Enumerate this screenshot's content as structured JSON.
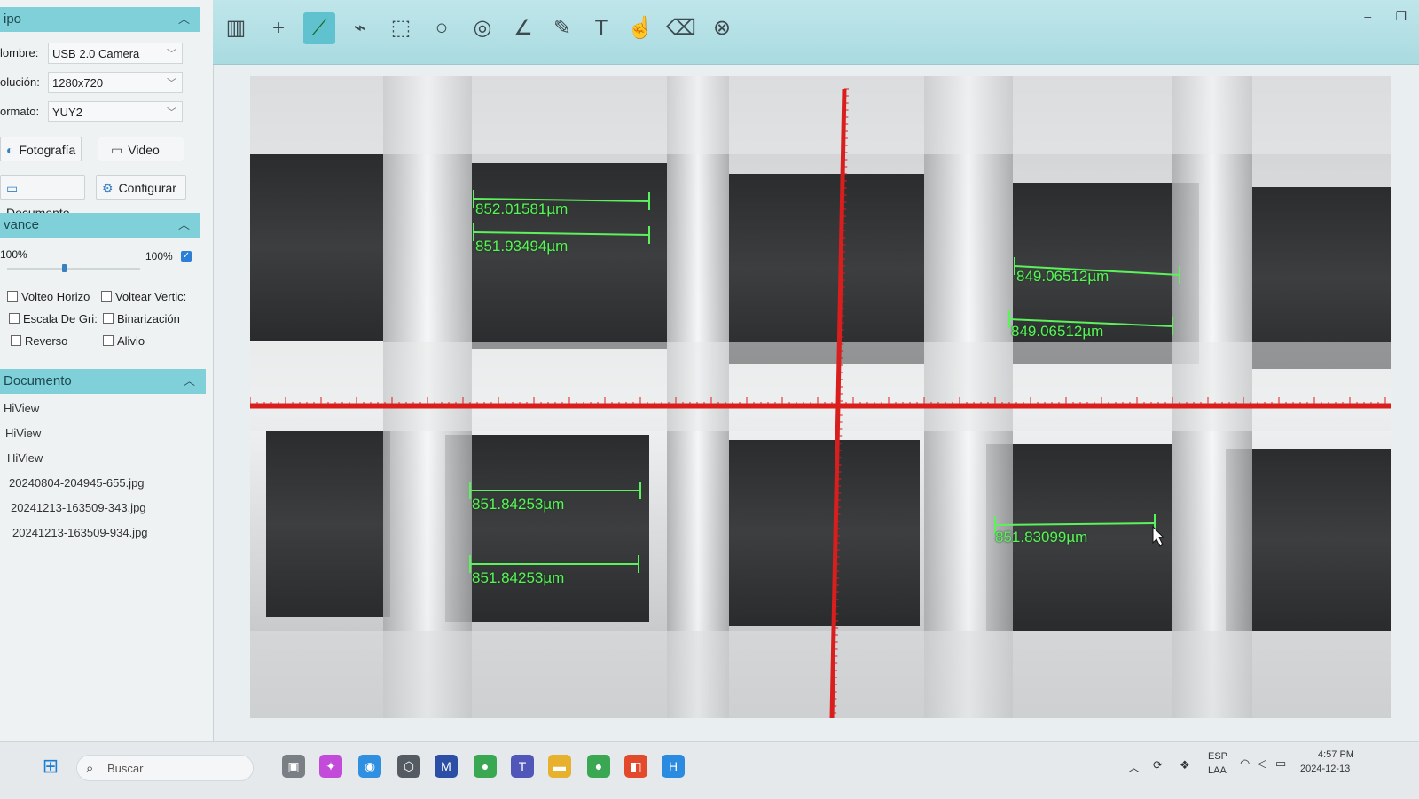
{
  "sidebar": {
    "equipo_header": "ipo",
    "nombre_label": "lombre:",
    "nombre_value": "USB 2.0 Camera",
    "resolucion_label": "olución:",
    "resolucion_value": "1280x720",
    "formato_label": "ormato:",
    "formato_value": "YUY2",
    "buttons": {
      "fotografia": "Fotografía",
      "video": "Video",
      "documento": "Documento",
      "configurar": "Configurar"
    },
    "avance_header": "vance",
    "zoom_left": "100%",
    "zoom_right": "100%",
    "checkboxes": [
      "Volteo Horizo",
      "Voltear Vertic:",
      "Escala De Gri:",
      "Binarización",
      "Reverso",
      "Alivio"
    ],
    "documento_header": "Documento",
    "files": [
      "HiView",
      "HiView",
      "HiView",
      "20240804-204945-655.jpg",
      "20241213-163509-343.jpg",
      "20241213-163509-934.jpg"
    ]
  },
  "toolbar": {
    "tools": [
      "columns-tool-icon",
      "crosshair-icon",
      "line-measure-icon",
      "polyline-icon",
      "rectangle-icon",
      "circle-icon",
      "concentric-circle-icon",
      "angle-icon",
      "pencil-icon",
      "text-icon",
      "hand-icon",
      "erase-icon",
      "close-circle-icon"
    ],
    "active_tool": "line-measure-icon"
  },
  "measurements": {
    "m1": "852.01581µm",
    "m2": "851.93494µm",
    "m3": "849.06512µm",
    "m4": "849.06512µm",
    "m5": "851.84253µm",
    "m6": "851.84253µm",
    "m7": "851.83099µm"
  },
  "taskbar": {
    "search_placeholder": "Buscar",
    "lang_top": "ESP",
    "lang_bottom": "LAA",
    "time": "4:57 PM",
    "date": "2024-12-13"
  },
  "colors": {
    "accent": "#7fd0d8",
    "measure": "#5cf25c",
    "crosshair": "#d91e1e"
  }
}
